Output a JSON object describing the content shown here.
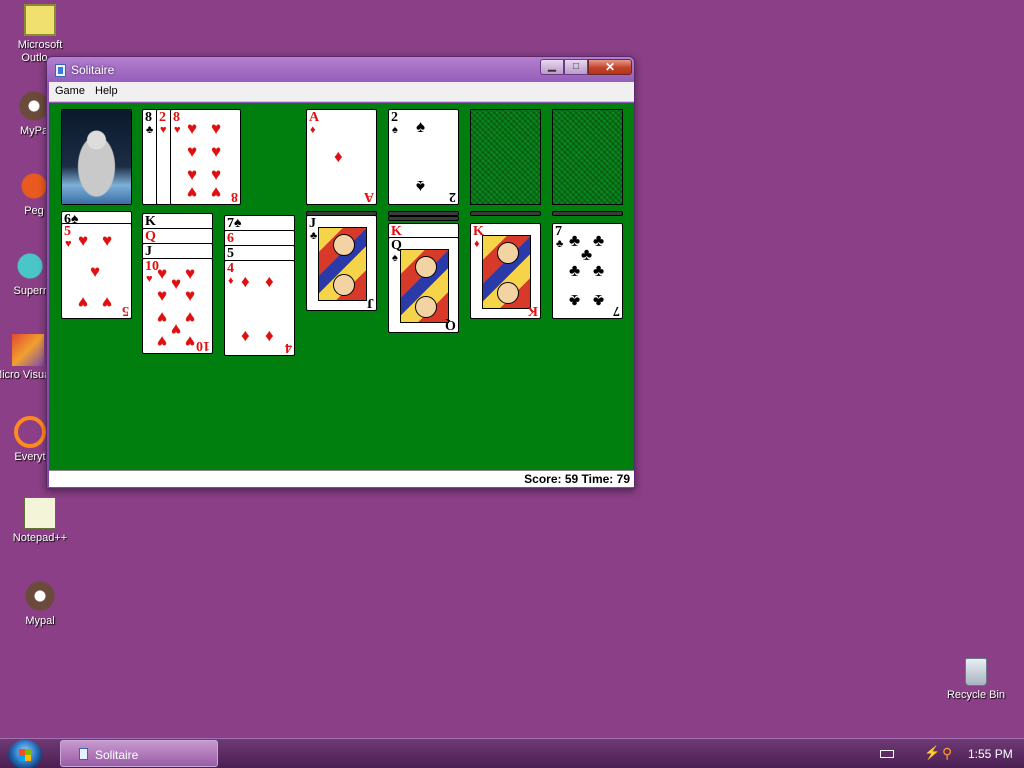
{
  "desktop": {
    "icons": [
      {
        "label": "Microsoft Outlo…",
        "icon": "outlook-icon"
      },
      {
        "label": "MyPa",
        "icon": "raccoon-icon"
      },
      {
        "label": "Peg",
        "icon": "pegasus-icon"
      },
      {
        "label": "Superr",
        "icon": "globe-icon"
      },
      {
        "label": "Micro Visual S",
        "icon": "visual-studio-icon"
      },
      {
        "label": "Everyt",
        "icon": "search-icon"
      },
      {
        "label": "Notepad++",
        "icon": "notepad-icon"
      },
      {
        "label": "Mypal",
        "icon": "raccoon-icon"
      },
      {
        "label": "Recycle Bin",
        "icon": "recycle-bin-icon"
      }
    ]
  },
  "window": {
    "title": "Solitaire",
    "menus": [
      "Game",
      "Help"
    ],
    "status": "Score: 59 Time: 79",
    "colors": {
      "felt": "#007f0e",
      "red_suit": "#e01010"
    }
  },
  "game": {
    "stock": "astronaut card back",
    "waste": [
      {
        "rank": "8",
        "suit": "♣"
      },
      {
        "rank": "2",
        "suit": "♥"
      },
      {
        "rank": "8",
        "suit": "♥"
      }
    ],
    "foundations": [
      {
        "rank": "A",
        "suit": "♦"
      },
      {
        "rank": "2",
        "suit": "♠"
      },
      {
        "rank": "",
        "suit": ""
      },
      {
        "rank": "",
        "suit": ""
      }
    ],
    "tableau": [
      {
        "fan": [
          "6♠"
        ],
        "top": {
          "rank": "5",
          "suit": "♥"
        }
      },
      {
        "fan": [
          "K",
          "Q",
          "J"
        ],
        "top": {
          "rank": "10",
          "suit": "♥"
        }
      },
      {
        "fan": [
          "7♠",
          "6",
          "5"
        ],
        "top": {
          "rank": "4",
          "suit": "♦"
        }
      },
      {
        "fan": [],
        "top": {
          "rank": "J",
          "suit": "♣"
        }
      },
      {
        "fan": [
          "K"
        ],
        "top": {
          "rank": "Q",
          "suit": "♠"
        }
      },
      {
        "fan": [],
        "top": {
          "rank": "K",
          "suit": "♦"
        }
      },
      {
        "fan": [],
        "top": {
          "rank": "7",
          "suit": "♣"
        }
      }
    ]
  },
  "taskbar": {
    "task_label": "Solitaire",
    "clock": "1:55 PM"
  }
}
